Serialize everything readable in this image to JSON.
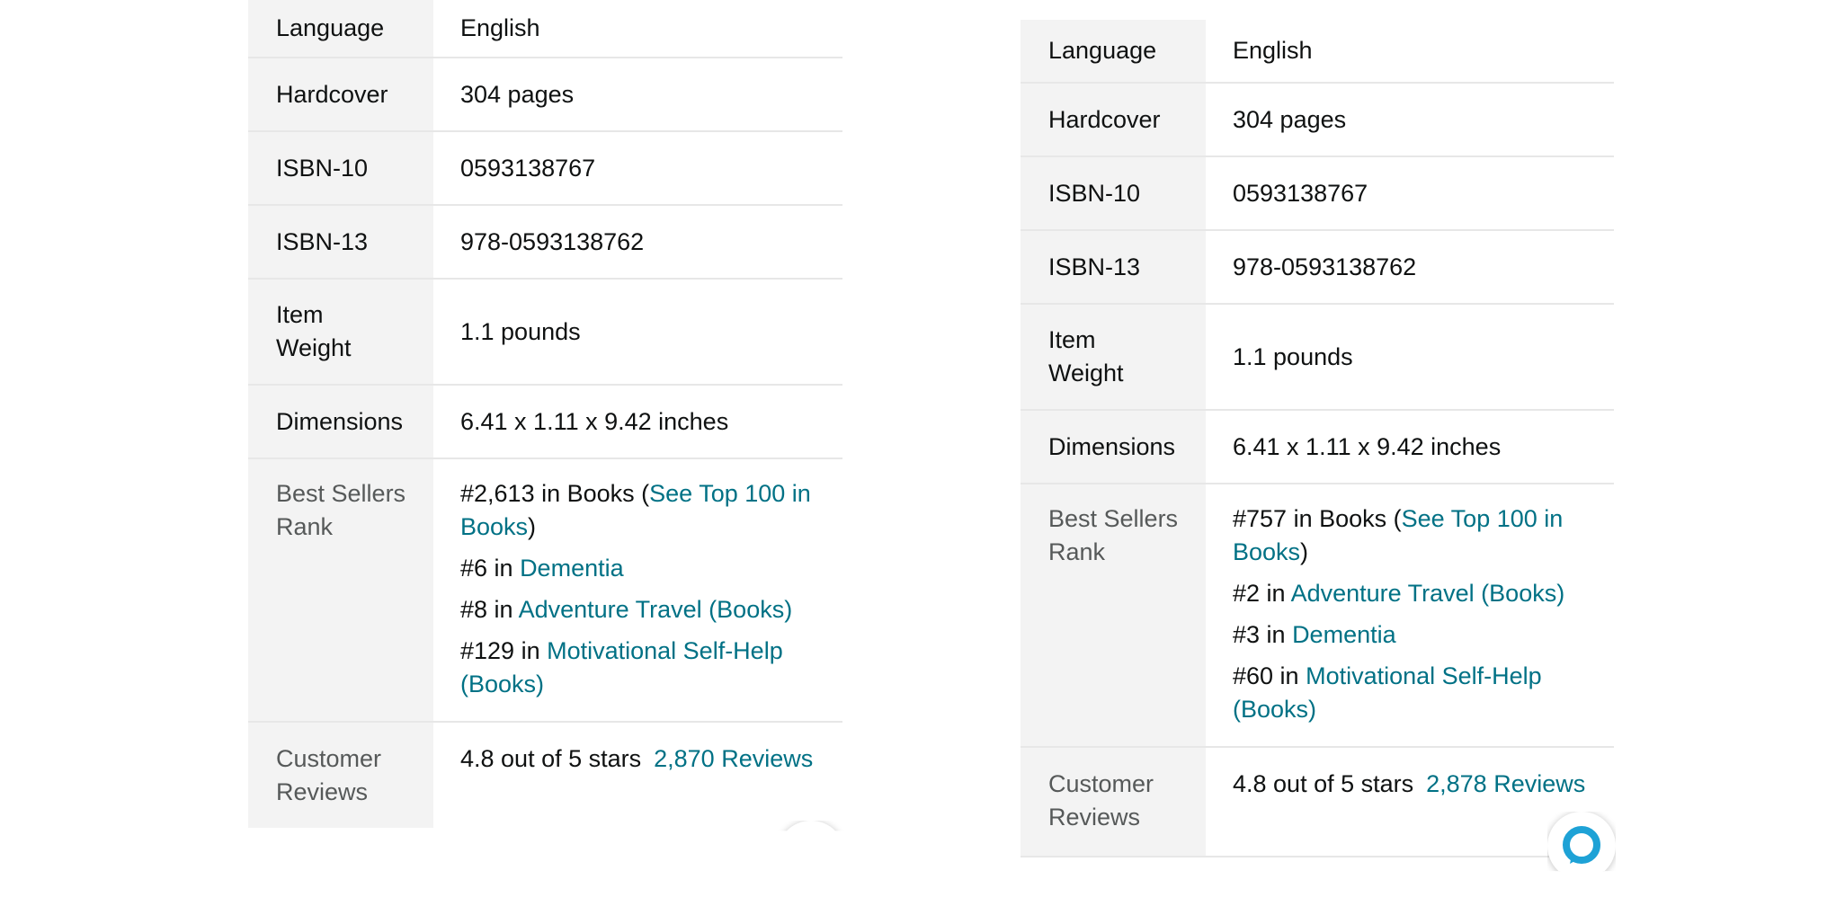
{
  "panels": [
    {
      "rows": {
        "language": {
          "key": "Language",
          "value": "English"
        },
        "hardcover": {
          "key": "Hardcover",
          "value": "304 pages"
        },
        "isbn10": {
          "key": "ISBN-10",
          "value": "0593138767"
        },
        "isbn13": {
          "key": "ISBN-13",
          "value": "978-0593138762"
        },
        "weight": {
          "key_line1": "Item",
          "key_line2": "Weight",
          "value": "1.1 pounds"
        },
        "dimensions": {
          "key": "Dimensions",
          "value": "6.41 x 1.11 x 9.42 inches"
        },
        "rank": {
          "key_line1": "Best Sellers",
          "key_line2": "Rank",
          "main_prefix": "#2,613 in Books (",
          "main_link": "See Top 100 in Books",
          "main_suffix": ")",
          "items": [
            {
              "prefix": "#6 in ",
              "link": "Dementia"
            },
            {
              "prefix": "#8 in ",
              "link": "Adventure Travel (Books)"
            },
            {
              "prefix": "#129 in ",
              "link": "Motivational Self-Help (Books)"
            }
          ]
        },
        "reviews": {
          "key_line1": "Customer",
          "key_line2": "Reviews",
          "rating_text": "4.8 out of 5 stars",
          "count_link": "2,870 Reviews"
        }
      }
    },
    {
      "rows": {
        "language": {
          "key": "Language",
          "value": "English"
        },
        "hardcover": {
          "key": "Hardcover",
          "value": "304 pages"
        },
        "isbn10": {
          "key": "ISBN-10",
          "value": "0593138767"
        },
        "isbn13": {
          "key": "ISBN-13",
          "value": "978-0593138762"
        },
        "weight": {
          "key_line1": "Item",
          "key_line2": "Weight",
          "value": "1.1 pounds"
        },
        "dimensions": {
          "key": "Dimensions",
          "value": "6.41 x 1.11 x 9.42 inches"
        },
        "rank": {
          "key_line1": "Best Sellers",
          "key_line2": "Rank",
          "main_prefix": "#757 in Books (",
          "main_link": "See Top 100 in Books",
          "main_suffix": ")",
          "items": [
            {
              "prefix": "#2 in ",
              "link": "Adventure Travel (Books)"
            },
            {
              "prefix": "#3 in ",
              "link": "Dementia"
            },
            {
              "prefix": "#60 in ",
              "link": "Motivational Self-Help (Books)"
            }
          ]
        },
        "reviews": {
          "key_line1": "Customer",
          "key_line2": "Reviews",
          "rating_text": "4.8 out of 5 stars",
          "count_link": "2,878 Reviews"
        }
      }
    }
  ],
  "colors": {
    "link": "#007185",
    "key_background": "#f3f3f3",
    "alexa_blue": "#1ea2d6"
  },
  "icons": {
    "assistant": "alexa-icon"
  }
}
